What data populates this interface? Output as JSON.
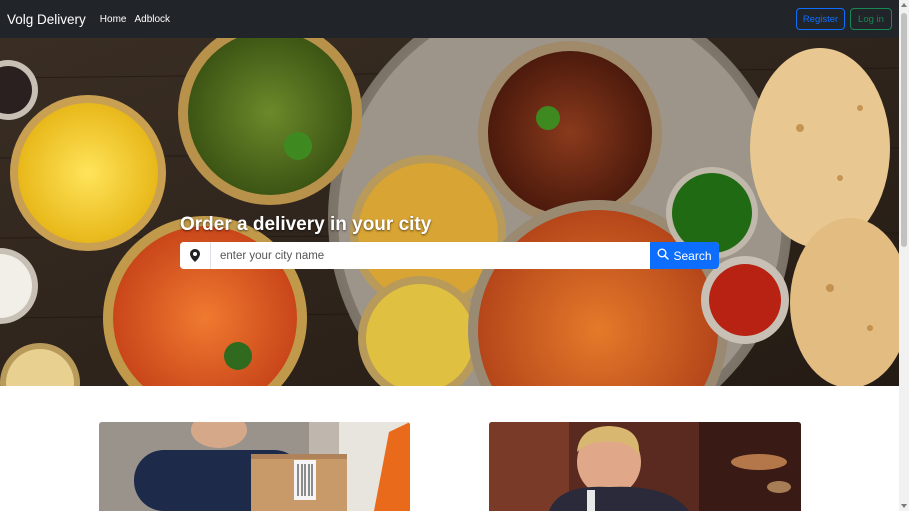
{
  "navbar": {
    "brand": "Volg Delivery",
    "links": [
      {
        "label": "Home"
      },
      {
        "label": "Adblock"
      }
    ],
    "register_label": "Register",
    "login_label": "Log in"
  },
  "hero": {
    "title": "Order a delivery in your city",
    "search": {
      "placeholder": "enter your city name",
      "value": "",
      "button_label": "Search",
      "location_icon": "map-pin-icon",
      "button_icon": "magnifier-icon"
    }
  },
  "cards": [
    {
      "image": "delivery-person-with-box"
    },
    {
      "image": "chef-cooking"
    }
  ],
  "colors": {
    "navbar_bg": "#212529",
    "primary": "#0d6efd",
    "success": "#198754"
  }
}
